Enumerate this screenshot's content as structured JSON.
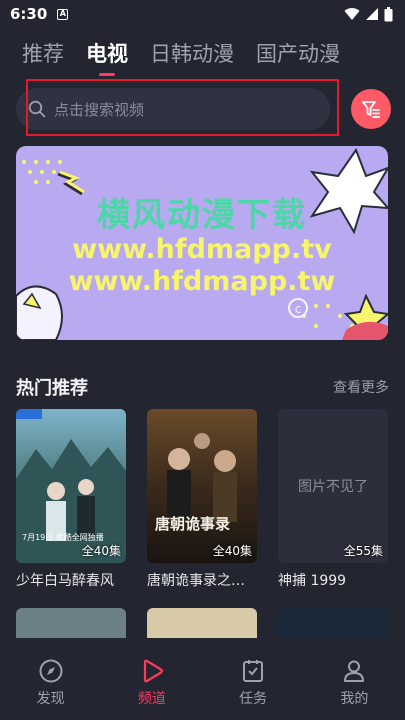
{
  "status_bar": {
    "time": "6:30",
    "badge": "A"
  },
  "tabs": [
    {
      "label": "推荐"
    },
    {
      "label": "电视"
    },
    {
      "label": "日韩动漫"
    },
    {
      "label": "国产动漫"
    }
  ],
  "search": {
    "placeholder": "点击搜索视频"
  },
  "banner": {
    "title": "横风动漫下载",
    "line1": "www.hfdmapp.tv",
    "line2": "www.hfdmapp.tw"
  },
  "section": {
    "title": "热门推荐",
    "more": "查看更多"
  },
  "cards": [
    {
      "name": "少年白马醉春风",
      "episodes": "全40集",
      "poster_text": "7月19日 优酷全网独播"
    },
    {
      "name": "唐朝诡事录之…",
      "episodes": "全40集",
      "poster_text": "唐朝诡事录"
    },
    {
      "name": "神捕 1999",
      "episodes": "全55集",
      "no_image_text": "图片不见了"
    }
  ],
  "bottom_nav": [
    {
      "label": "发现",
      "icon": "compass-icon"
    },
    {
      "label": "频道",
      "icon": "play-icon"
    },
    {
      "label": "任务",
      "icon": "task-icon"
    },
    {
      "label": "我的",
      "icon": "user-icon"
    }
  ],
  "colors": {
    "accent": "#ff3a5e",
    "background": "#232631",
    "highlight_box": "#e4192c"
  }
}
